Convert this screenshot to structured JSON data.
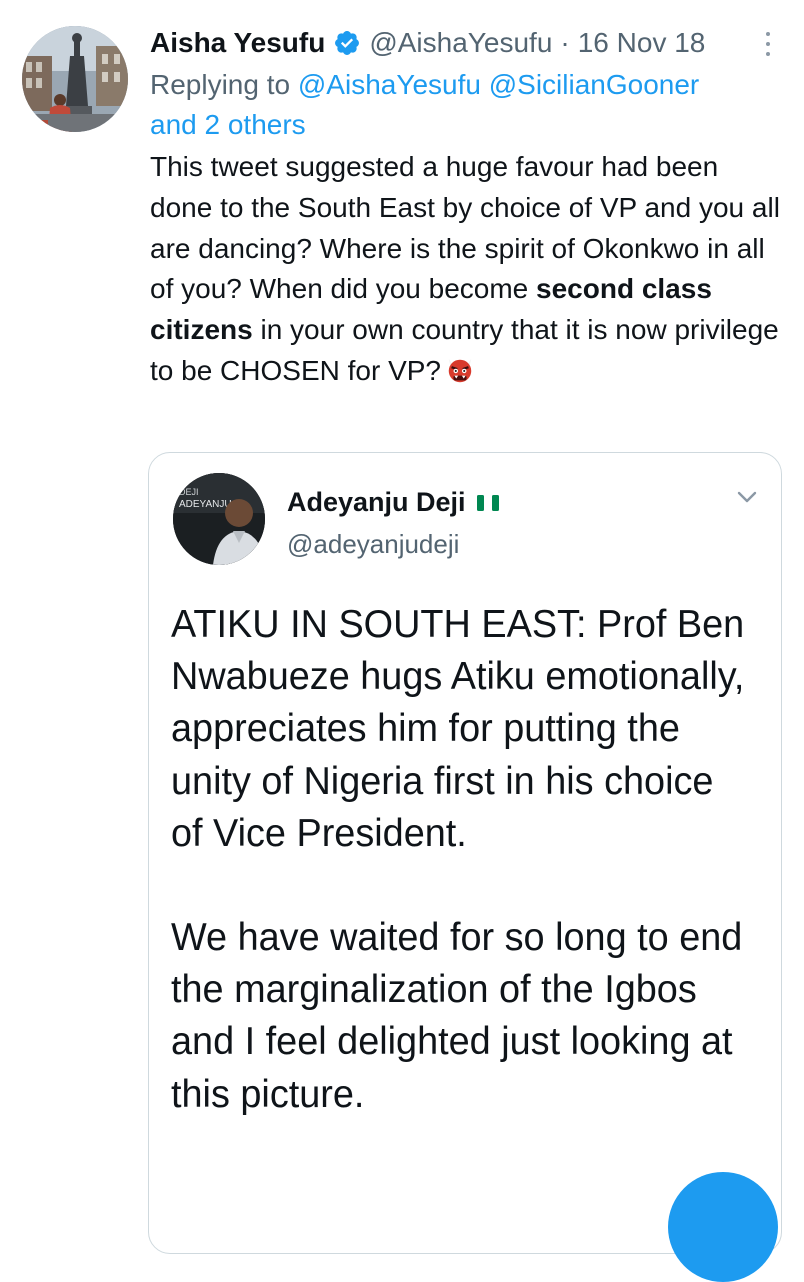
{
  "tweet": {
    "author_name": "Aisha Yesufu",
    "handle": "@AishaYesufu",
    "separator": "·",
    "date": "16 Nov 18",
    "replying_prefix": "Replying to",
    "reply_handles": "@AishaYesufu @SicilianGooner",
    "reply_others": "and 2 others",
    "text_1": "This tweet suggested a huge favour had been done to the South East by choice of VP and you all are dancing? Where is the spirit of Okonkwo in all of you? When did you become ",
    "text_bold": "second class citizens",
    "text_2": " in your own country that it is now privilege to be CHOSEN for VP?",
    "emoji": "japanese-ogre-emoji"
  },
  "quoted_tweet": {
    "author_name": "Adeyanju Deji",
    "flag": "nigeria-flag",
    "handle": "@adeyanjudeji",
    "avatar_caption_1": "DEJI",
    "avatar_caption_2": "ADEYANJU",
    "paragraph_1": "ATIKU IN SOUTH EAST: Prof Ben Nwabueze hugs Atiku emotionally, appreciates him for putting the unity of Nigeria first in his choice of Vice President.",
    "paragraph_2": "We have waited for so long to end the marginalization of the Igbos and I feel delighted just looking at this picture."
  },
  "colors": {
    "accent": "#1d9bf0",
    "text": "#0f1419",
    "secondary": "#536471"
  }
}
